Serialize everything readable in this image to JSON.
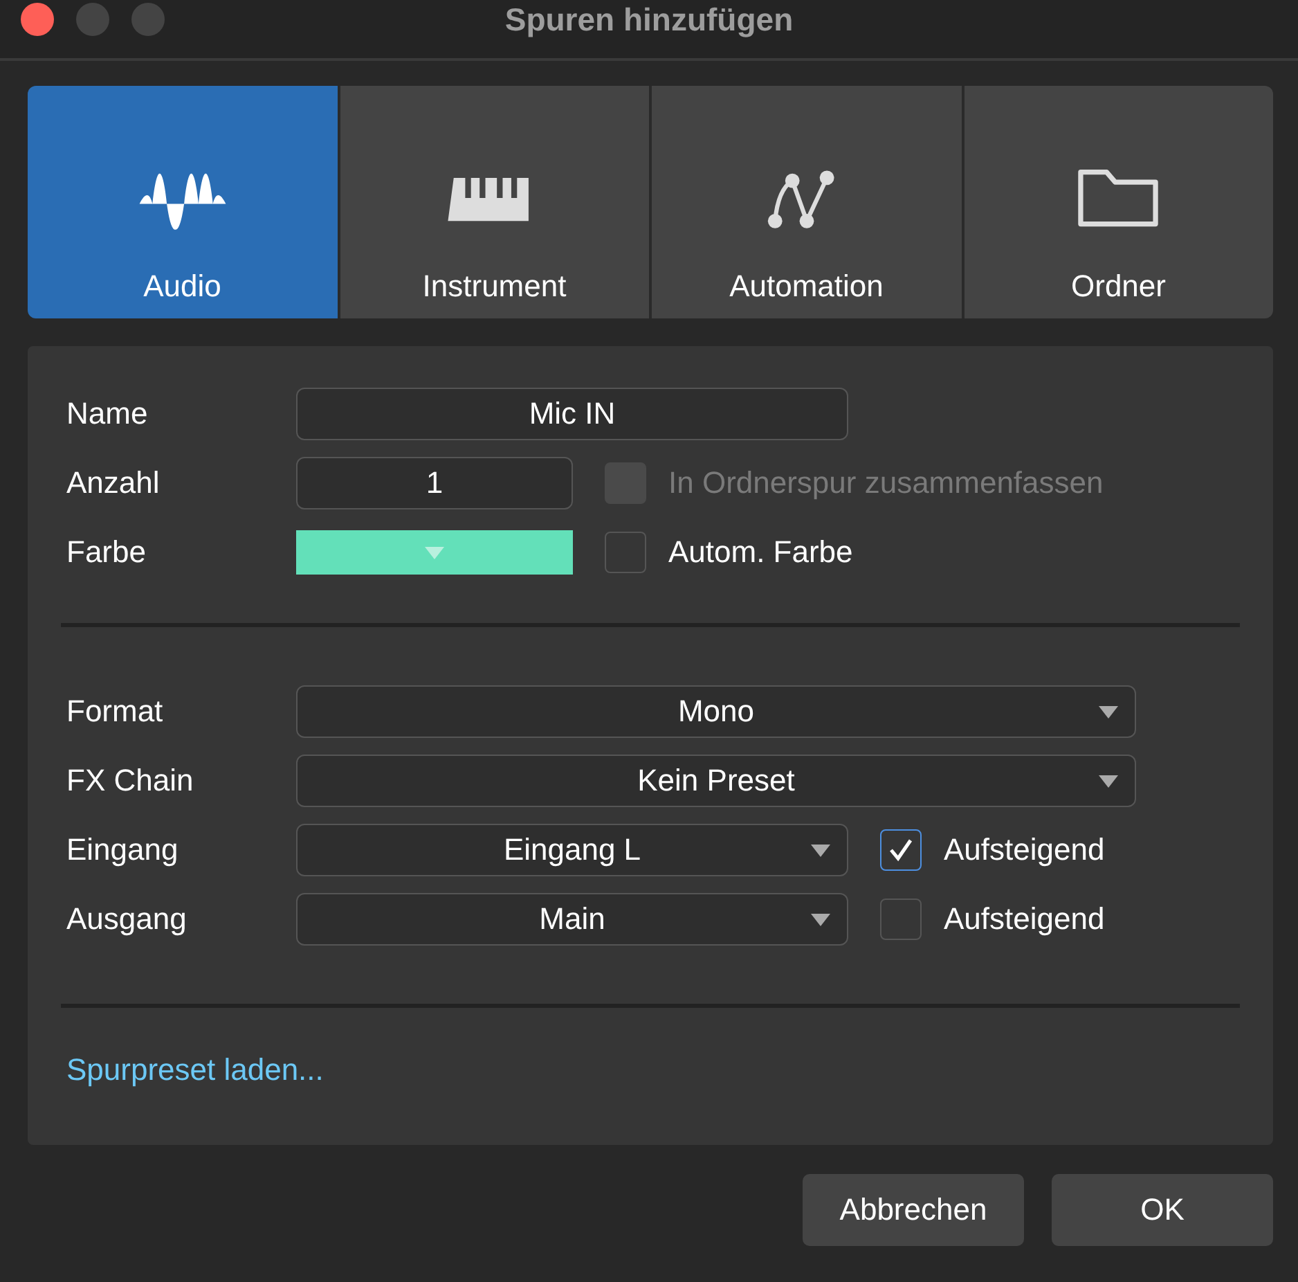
{
  "window": {
    "title": "Spuren hinzufügen"
  },
  "tabs": [
    {
      "label": "Audio",
      "kind": "audio",
      "selected": true
    },
    {
      "label": "Instrument",
      "kind": "instrument",
      "selected": false
    },
    {
      "label": "Automation",
      "kind": "automation",
      "selected": false
    },
    {
      "label": "Ordner",
      "kind": "folder",
      "selected": false
    }
  ],
  "general": [
    {
      "label": "Name",
      "kind": "text",
      "value": "Mic IN"
    },
    {
      "label": "Anzahl",
      "kind": "text",
      "value": "1",
      "option": {
        "label": "In Ordnerspur zusammenfassen",
        "checked": false,
        "disabled": true
      }
    },
    {
      "label": "Farbe",
      "kind": "color",
      "color": "#63e0b9",
      "option": {
        "label": "Autom. Farbe",
        "checked": false,
        "disabled": false
      }
    }
  ],
  "routing": [
    {
      "label": "Format",
      "value": "Mono"
    },
    {
      "label": "FX Chain",
      "value": "Kein Preset"
    },
    {
      "label": "Eingang",
      "value": "Eingang L",
      "option": {
        "label": "Aufsteigend",
        "checked": true,
        "disabled": false
      }
    },
    {
      "label": "Ausgang",
      "value": "Main",
      "option": {
        "label": "Aufsteigend",
        "checked": false,
        "disabled": false
      }
    }
  ],
  "preset_link": "Spurpreset laden...",
  "buttons": [
    {
      "label": "Abbrechen"
    },
    {
      "label": "OK"
    }
  ]
}
